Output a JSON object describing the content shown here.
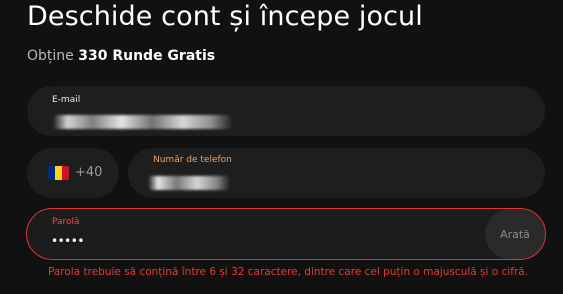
{
  "header": {
    "title": "Deschide cont și începe jocul",
    "subtitle_prefix": "Obține",
    "subtitle_bold": "330 Runde Gratis"
  },
  "form": {
    "email": {
      "label": "E-mail"
    },
    "phone": {
      "country_flag": "romania-flag",
      "flag_colors": [
        "#002b7f",
        "#fcd116",
        "#ce1126"
      ],
      "prefix": "+40",
      "label": "Număr de telefon"
    },
    "password": {
      "label": "Parolă",
      "value": "•••••",
      "show_label": "Arată",
      "error": "Parola trebuie să conțină între 6 și 32 caractere, dintre care cel puțin o majusculă și o cifră."
    }
  },
  "colors": {
    "background": "#111111",
    "field_background": "#1e1e1e",
    "error": "#e53935",
    "phone_label": "#f0a060"
  }
}
